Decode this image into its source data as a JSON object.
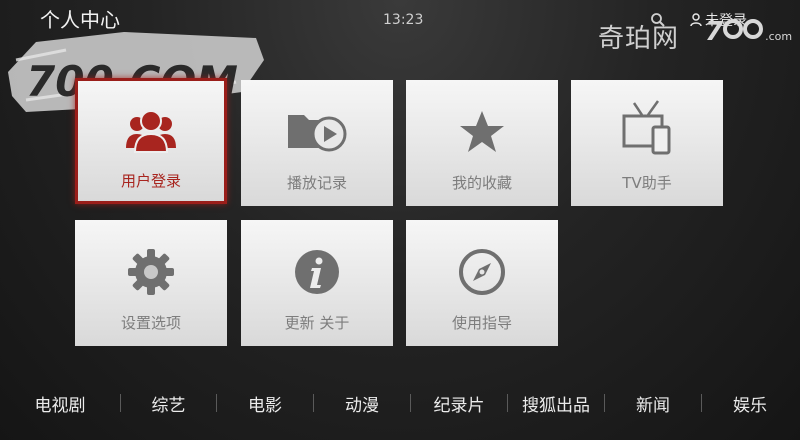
{
  "header": {
    "title": "个人中心",
    "time": "13:23",
    "brand_name": "奇珀网",
    "brand_logo": "7",
    "brand_logo_suffix": ".com",
    "user_status": "未登录"
  },
  "watermark": {
    "text": "700.COM"
  },
  "tiles": [
    {
      "label": "用户登录",
      "icon": "users-icon",
      "selected": true
    },
    {
      "label": "播放记录",
      "icon": "folder-play-icon"
    },
    {
      "label": "我的收藏",
      "icon": "star-icon"
    },
    {
      "label": "TV助手",
      "icon": "tv-phone-icon"
    },
    {
      "label": "设置选项",
      "icon": "gear-icon"
    },
    {
      "label": "更新 关于",
      "icon": "info-icon"
    },
    {
      "label": "使用指导",
      "icon": "compass-icon"
    }
  ],
  "nav": [
    "电视剧",
    "综艺",
    "电影",
    "动漫",
    "纪录片",
    "搜狐出品",
    "新闻",
    "娱乐"
  ],
  "colors": {
    "accent": "#9a1e1a",
    "tile_icon": "#6f6f6f",
    "tile_label": "#7d7d7d"
  }
}
